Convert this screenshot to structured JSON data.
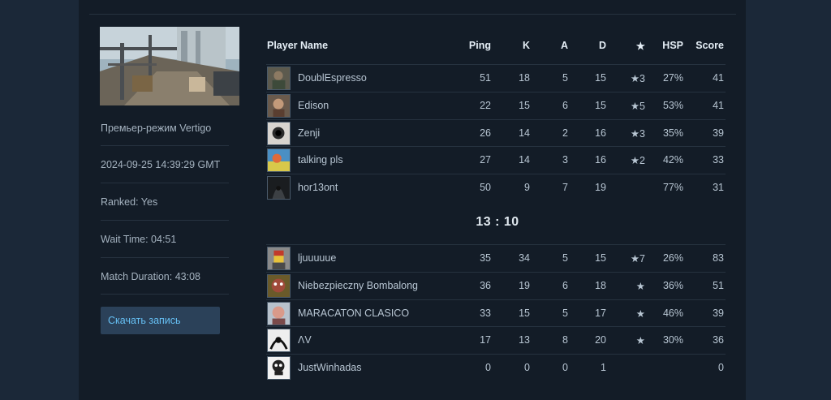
{
  "match": {
    "mode": "Премьер-режим Vertigo",
    "date": "2024-09-25 14:39:29 GMT",
    "ranked": "Ranked: Yes",
    "wait_time": "Wait Time: 04:51",
    "duration": "Match Duration: 43:08",
    "download_label": "Скачать запись"
  },
  "table": {
    "headers": {
      "name": "Player Name",
      "ping": "Ping",
      "k": "K",
      "a": "A",
      "d": "D",
      "star": "★",
      "hsp": "HSP",
      "score": "Score"
    },
    "team1": [
      {
        "name": "DoublEspresso",
        "ping": "51",
        "k": "18",
        "a": "5",
        "d": "15",
        "star": "★3",
        "hsp": "27%",
        "score": "41",
        "avatar": "avatar-soldier"
      },
      {
        "name": "Edison",
        "ping": "22",
        "k": "15",
        "a": "6",
        "d": "15",
        "star": "★5",
        "hsp": "53%",
        "score": "41",
        "avatar": "avatar-face"
      },
      {
        "name": "Zenji",
        "ping": "26",
        "k": "14",
        "a": "2",
        "d": "16",
        "star": "★3",
        "hsp": "35%",
        "score": "39",
        "avatar": "avatar-hole"
      },
      {
        "name": "talking pls",
        "ping": "27",
        "k": "14",
        "a": "3",
        "d": "16",
        "star": "★2",
        "hsp": "42%",
        "score": "33",
        "avatar": "avatar-colorful"
      },
      {
        "name": "hor13ont",
        "ping": "50",
        "k": "9",
        "a": "7",
        "d": "19",
        "star": "",
        "hsp": "77%",
        "score": "31",
        "avatar": "avatar-hood"
      }
    ],
    "round_score": "13 : 10",
    "team2": [
      {
        "name": "ljuuuuue",
        "ping": "35",
        "k": "34",
        "a": "5",
        "d": "15",
        "star": "★7",
        "hsp": "26%",
        "score": "83",
        "avatar": "avatar-lego"
      },
      {
        "name": "Niebezpieczny Bombalong",
        "ping": "36",
        "k": "19",
        "a": "6",
        "d": "18",
        "star": "★",
        "hsp": "36%",
        "score": "51",
        "avatar": "avatar-monster"
      },
      {
        "name": "MARACATON CLASICO",
        "ping": "33",
        "k": "15",
        "a": "5",
        "d": "17",
        "star": "★",
        "hsp": "46%",
        "score": "39",
        "avatar": "avatar-man"
      },
      {
        "name": "ΛV",
        "ping": "17",
        "k": "13",
        "a": "8",
        "d": "20",
        "star": "★",
        "hsp": "30%",
        "score": "36",
        "avatar": "avatar-bw"
      },
      {
        "name": "JustWinhadas",
        "ping": "0",
        "k": "0",
        "a": "0",
        "d": "1",
        "star": "",
        "hsp": "",
        "score": "0",
        "avatar": "avatar-skull"
      }
    ]
  }
}
